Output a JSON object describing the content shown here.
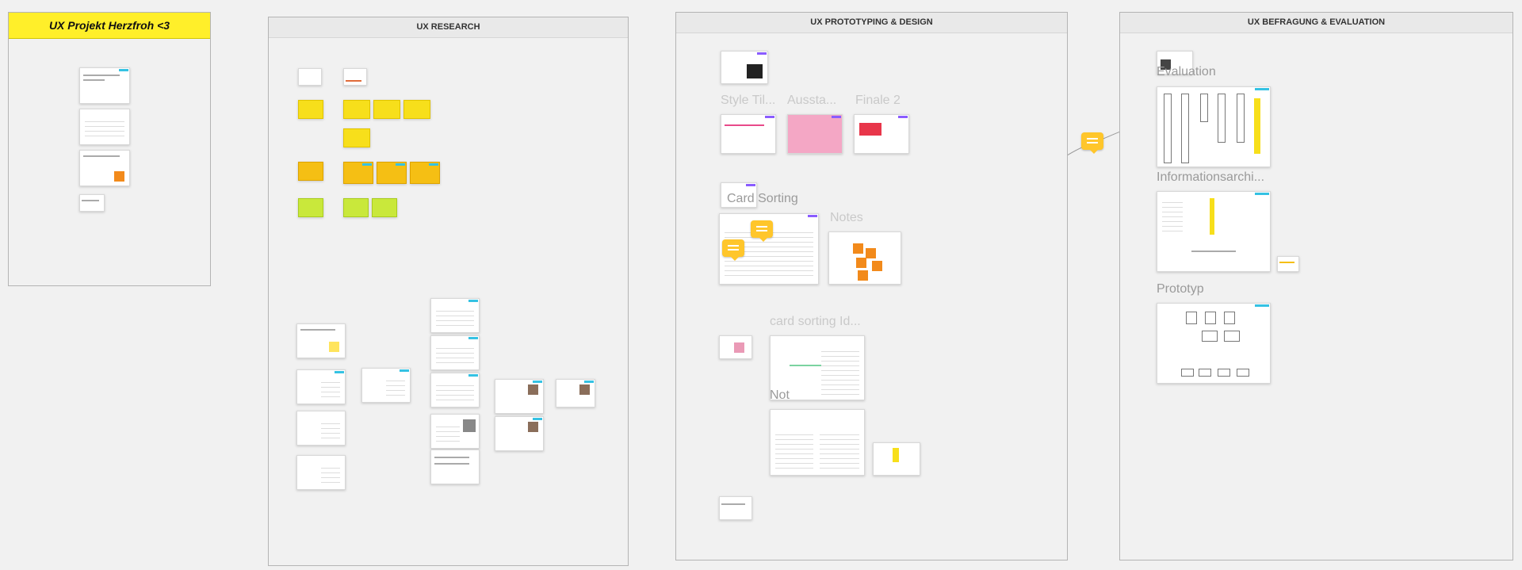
{
  "frames": {
    "project": {
      "title": "UX Projekt Herzfroh <3"
    },
    "research": {
      "title": "UX RESEARCH"
    },
    "prototyping": {
      "title": "UX PROTOTYPING & DESIGN"
    },
    "evaluation": {
      "title": "UX BEFRAGUNG & EVALUATION"
    }
  },
  "labels": {
    "style_tiles": "Style Til...",
    "aussta": "Aussta...",
    "finale": "Finale 2",
    "card_sorting": "Card Sorting",
    "notes": "Notes",
    "card_sorting_id": "card sorting Id...",
    "not": "Not",
    "evaluation": "Evaluation",
    "informationsarchi": "Informationsarchi...",
    "prototyp": "Prototyp"
  },
  "colors": {
    "canvas": "#f1f1f1",
    "accent_yellow": "#ffef2a",
    "card_tag_cyan": "#35c2e3",
    "card_tag_purple": "#8a5cff",
    "comment": "#ffc62b"
  }
}
